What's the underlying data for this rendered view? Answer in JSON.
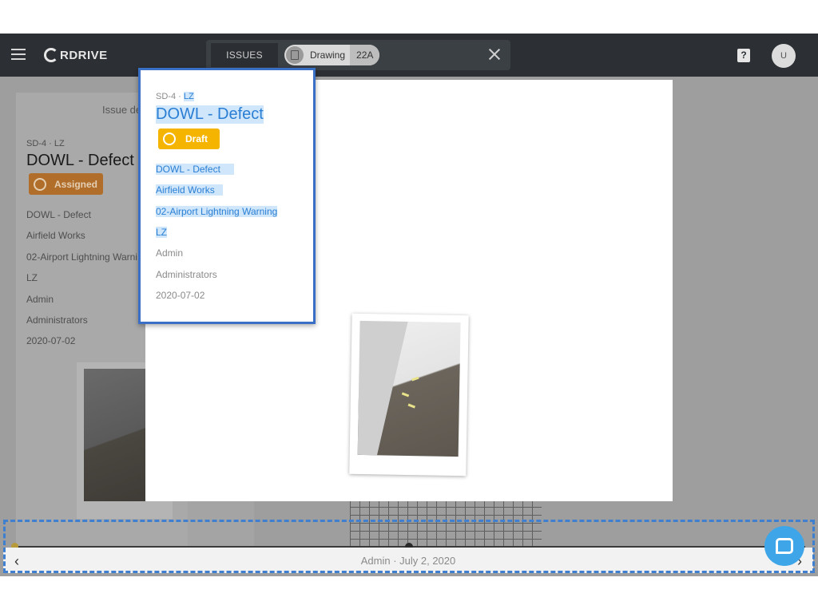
{
  "header": {
    "brand": "RDRIVE",
    "tab_issues": "ISSUES",
    "filter_chip_label": "Drawing",
    "filter_chip_count": "22A",
    "help_glyph": "?",
    "user_initial": "U"
  },
  "background_card": {
    "heading": "Issue de",
    "meta": "SD-4 · LZ",
    "title": "DOWL - Defect",
    "status": "Assigned",
    "status_color": "#b06e2a",
    "fields": [
      "DOWL - Defect",
      "Airfield Works",
      "02-Airport Lightning Warni",
      "LZ",
      "Admin",
      "Administrators",
      "2020-07-02"
    ]
  },
  "detail_card": {
    "meta_prefix": "SD-4 · ",
    "meta_zone": "LZ",
    "title": "DOWL - Defect",
    "status": "Draft",
    "status_color": "#f4b400",
    "fields": {
      "issue_type": "DOWL - Defect",
      "category": "Airfield Works",
      "drawing": "02-Airport Lightning Warning",
      "zone": "LZ",
      "author": "Admin",
      "group": "Administrators",
      "date": "2020-07-02"
    }
  },
  "footer": {
    "caption": "Admin · July 2, 2020",
    "prev_glyph": "‹",
    "next_glyph": "›"
  },
  "colors": {
    "accent": "#3f7fd0",
    "highlight": "#cfe6fb",
    "topbar": "#2c3034"
  },
  "icons": [
    "menu-icon",
    "brand-logo-icon",
    "drawing-icon",
    "close-icon",
    "help-icon",
    "chat-icon",
    "status-ring-icon"
  ]
}
